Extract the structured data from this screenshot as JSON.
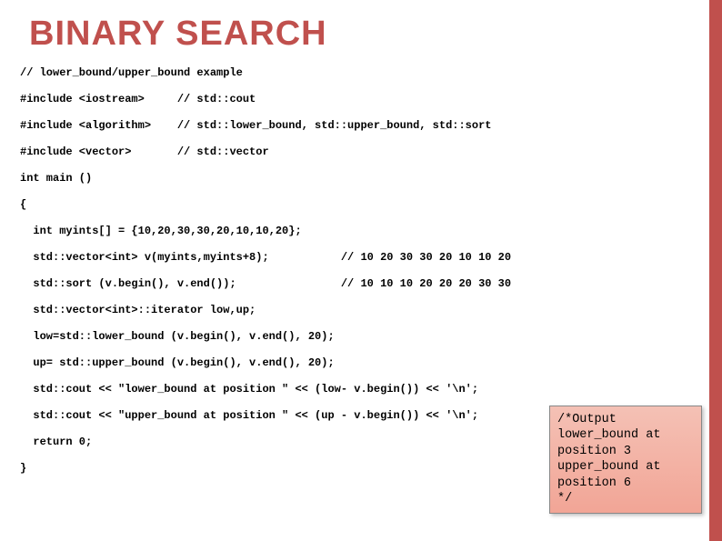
{
  "title": "BINARY SEARCH",
  "code": {
    "l1": "// lower_bound/upper_bound example",
    "l2": "#include <iostream>     // std::cout",
    "l3": "#include <algorithm>    // std::lower_bound, std::upper_bound, std::sort",
    "l4": "#include <vector>       // std::vector",
    "l5": "int main ()",
    "l6": "{",
    "l7": "  int myints[] = {10,20,30,30,20,10,10,20};",
    "l8": "  std::vector<int> v(myints,myints+8);           // 10 20 30 30 20 10 10 20",
    "l9": "  std::sort (v.begin(), v.end());                // 10 10 10 20 20 20 30 30",
    "l10": "  std::vector<int>::iterator low,up;",
    "l11": "  low=std::lower_bound (v.begin(), v.end(), 20);",
    "l12": "  up= std::upper_bound (v.begin(), v.end(), 20);",
    "l13": "  std::cout << \"lower_bound at position \" << (low- v.begin()) << '\\n';",
    "l14": "  std::cout << \"upper_bound at position \" << (up - v.begin()) << '\\n';",
    "l15": "  return 0;",
    "l16": "}"
  },
  "output": {
    "l1": "/*Output",
    "l2": "lower_bound at",
    "l3": "position 3",
    "l4": "upper_bound at",
    "l5": "position 6",
    "l6": "*/"
  }
}
